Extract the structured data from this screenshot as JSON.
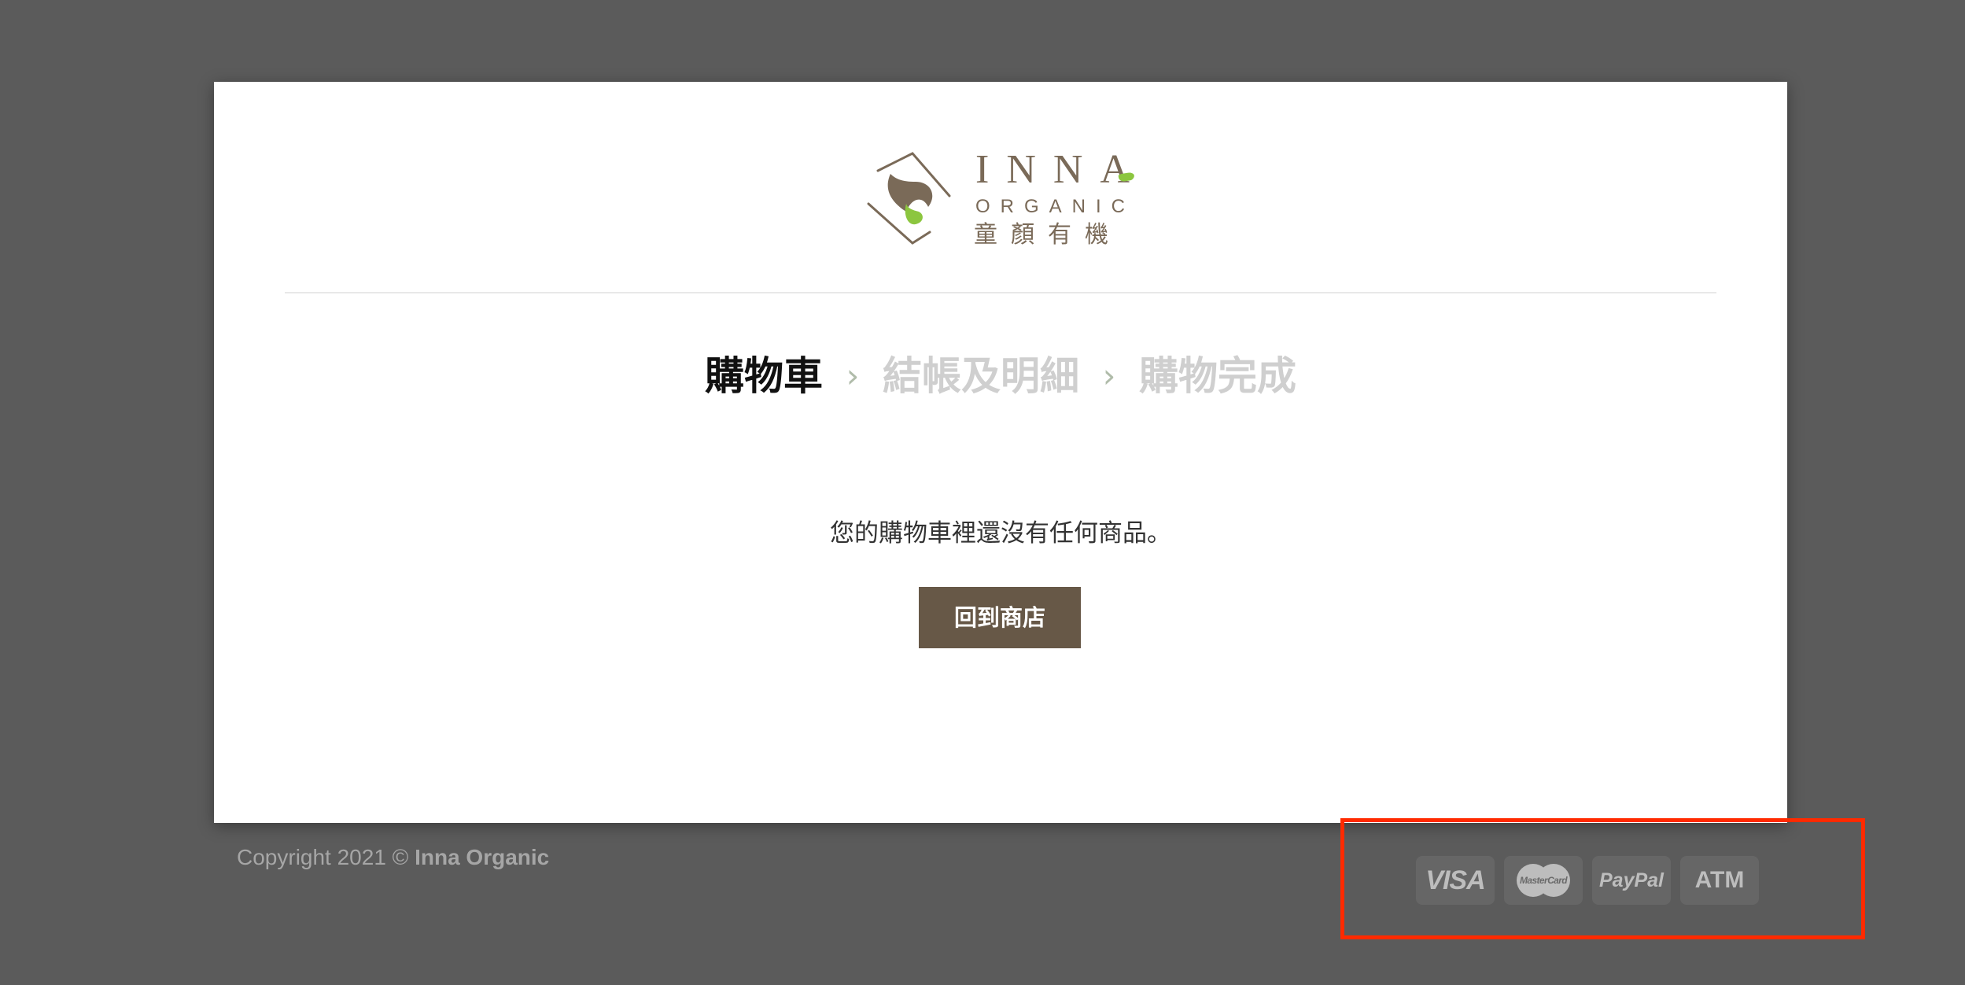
{
  "brand": {
    "logo_name": "INNA",
    "logo_subtitle": "ORGANIC",
    "logo_chinese": "童顏有機",
    "colors": {
      "brand_brown": "#7a6a58",
      "leaf_green": "#8cc63f",
      "button_bg": "#675847",
      "highlight_red": "#ff2a00"
    }
  },
  "checkout_steps": [
    {
      "label": "購物車",
      "state": "active"
    },
    {
      "label": "結帳及明細",
      "state": "inactive"
    },
    {
      "label": "購物完成",
      "state": "inactive"
    }
  ],
  "step_separator": "›",
  "cart": {
    "empty_message": "您的購物車裡還沒有任何商品。",
    "return_button_label": "回到商店"
  },
  "footer": {
    "copyright_prefix": "Copyright 2021 ©",
    "copyright_brand": "Inna Organic",
    "payment_methods": [
      {
        "name": "VISA",
        "icon": "visa-icon"
      },
      {
        "name": "MasterCard",
        "icon": "mastercard-icon"
      },
      {
        "name": "PayPal",
        "icon": "paypal-icon"
      },
      {
        "name": "ATM",
        "icon": "atm-icon"
      }
    ]
  }
}
